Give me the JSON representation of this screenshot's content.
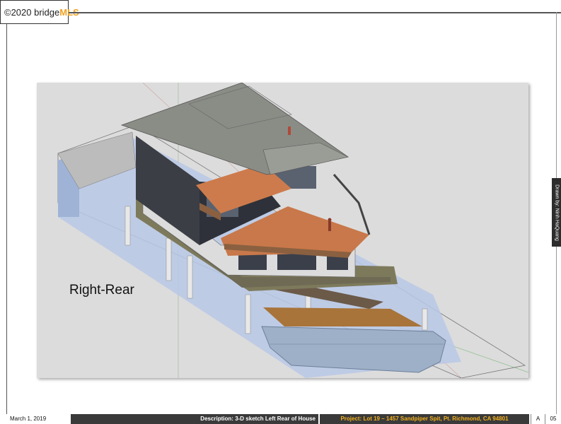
{
  "watermark": {
    "copyright": "©2020 bridge",
    "mls": "MLS"
  },
  "sketch": {
    "view_label": "Right-Rear"
  },
  "side_tab": {
    "text": "Drawn by: Ninh HaQuang"
  },
  "title_block": {
    "date": "March 1, 2019",
    "description": "Description: 3-D sketch Left Rear of House",
    "project": "Project: Lot 19 – 1457 Sandpiper Spit, Pt. Richmond, CA 94801",
    "revision": "A",
    "sheet": "05"
  }
}
